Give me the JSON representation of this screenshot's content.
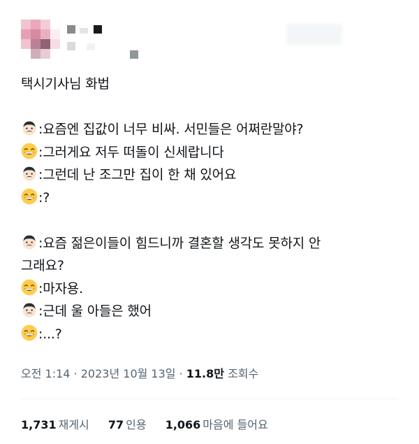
{
  "tweet": {
    "title": "택시기사님 화법",
    "dialogue_1": [
      {
        "speaker": "driver-icon",
        "text": ":요즘엔 집값이 너무 비싸. 서민들은 어쩌란말야?"
      },
      {
        "speaker": "grin-icon",
        "text": ":그러게요 저두 떠돌이 신세랍니다"
      },
      {
        "speaker": "driver-icon",
        "text": ":그런데 난 조그만 집이 한 채 있어요"
      },
      {
        "speaker": "grin-icon",
        "text": ":?"
      }
    ],
    "dialogue_2_first": {
      "speaker": "driver-icon",
      "text": ":요즘 젊은이들이 힘드니까 결혼할 생각도 못하지 안"
    },
    "dialogue_2_first_cont": "그래요?",
    "dialogue_2_rest": [
      {
        "speaker": "grin-icon",
        "text": ":마자용."
      },
      {
        "speaker": "driver-icon",
        "text": ":근데 울 아들은 했어"
      },
      {
        "speaker": "grin-icon",
        "text": ":...?"
      }
    ]
  },
  "meta": {
    "time": "오전 1:14",
    "separator": " · ",
    "date": "2023년 10월 13일",
    "views_count": "11.8만",
    "views_label": "조회수"
  },
  "stats": {
    "reposts_count": "1,731",
    "reposts_label": "재게시",
    "quotes_count": "77",
    "quotes_label": "인용",
    "likes_count": "1,066",
    "likes_label": "마음에 들어요"
  },
  "colors": {
    "text": "#0f1419",
    "secondary": "#536471",
    "divider": "#eff3f4",
    "grin_face": "#ffcc4d",
    "driver_hair": "#292f33"
  }
}
